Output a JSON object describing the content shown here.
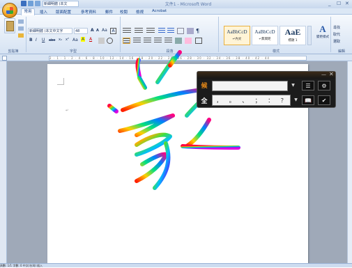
{
  "window": {
    "title": "文件1 - Microsoft Word",
    "controls": [
      "_",
      "☐",
      "✕"
    ],
    "qat_font_box": "新細明體 (本文"
  },
  "tabs": [
    {
      "label": "常用",
      "active": true
    },
    {
      "label": "插入"
    },
    {
      "label": "版面配置"
    },
    {
      "label": "參考資料"
    },
    {
      "label": "郵件"
    },
    {
      "label": "校閱"
    },
    {
      "label": "檢視"
    },
    {
      "label": "Acrobat"
    }
  ],
  "ribbon": {
    "clipboard": {
      "label": "剪貼簿"
    },
    "font": {
      "label": "字型",
      "font_name": "新細明體 (本文中文字",
      "font_size": "48",
      "row1_icons": [
        "A",
        "A",
        "Aa",
        "A"
      ],
      "row2_icons": [
        "B",
        "I",
        "U",
        "abe",
        "x₂",
        "x²",
        "Aa",
        "A",
        "A"
      ]
    },
    "paragraph": {
      "label": "段落"
    },
    "styles": {
      "label": "樣式",
      "items": [
        {
          "sample": "AaBbCcD",
          "name": "↵內文"
        },
        {
          "sample": "AaBbCcD",
          "name": "↵無間距"
        },
        {
          "sample": "AaE",
          "name": "標題 1"
        }
      ],
      "change_styles": "變更樣式"
    },
    "editing": {
      "label": "編輯",
      "items": [
        "尋找",
        "取代",
        "選取"
      ]
    }
  },
  "ruler": {
    "ticks": "2 · 1 · 1 · 2 · 4 · 6 · 8 · 10 · 12 · 14 · 16 · 18 · 20 · 22 · 24 · 26 · 28 · 30 · 32 · 34 · 36 · 38 · 40 · 42 · 44"
  },
  "ime": {
    "candidate_label": "候",
    "fullwidth_label": "全",
    "input_value": "",
    "symbols": [
      "，",
      "。",
      "、",
      "；",
      "：",
      "？"
    ],
    "buttons": [
      "☰",
      "⚙",
      "📖",
      "✔"
    ]
  },
  "statusbar": {
    "text": "頁數: 1/1    字數: 0    中文(台灣)    插入"
  },
  "colors": {
    "ime_accent": "#e88a18",
    "ribbon_text": "#15428b"
  }
}
